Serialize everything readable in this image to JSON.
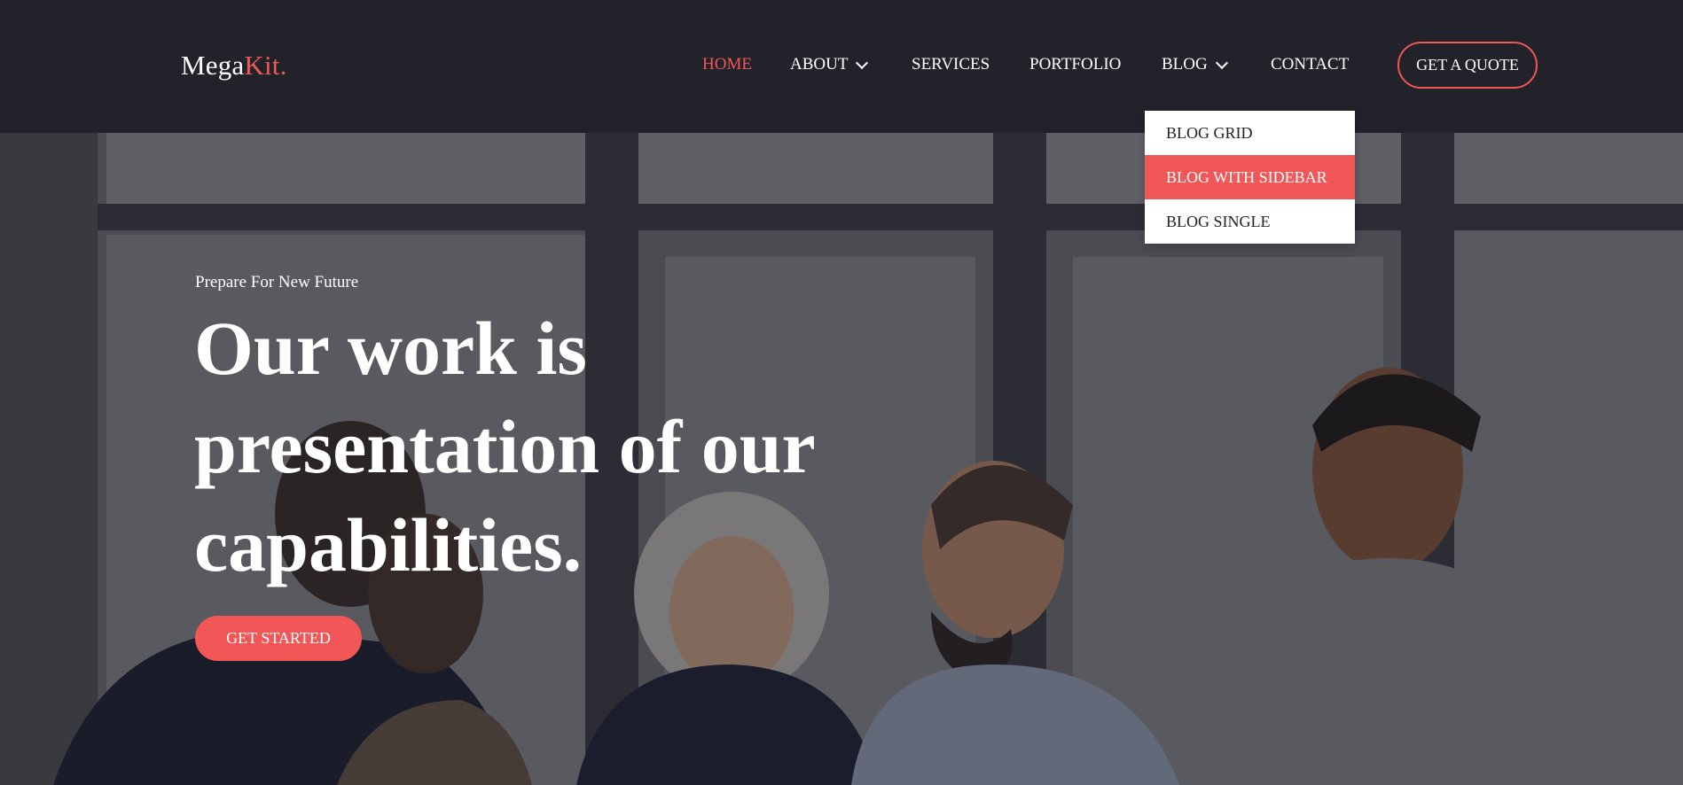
{
  "brand": {
    "name_main": "Mega",
    "name_accent": "Kit."
  },
  "nav": {
    "items": [
      {
        "label": "HOME",
        "active": true,
        "has_dropdown": false
      },
      {
        "label": "ABOUT",
        "active": false,
        "has_dropdown": true
      },
      {
        "label": "SERVICES",
        "active": false,
        "has_dropdown": false
      },
      {
        "label": "PORTFOLIO",
        "active": false,
        "has_dropdown": false
      },
      {
        "label": "BLOG",
        "active": false,
        "has_dropdown": true
      },
      {
        "label": "CONTACT",
        "active": false,
        "has_dropdown": false
      }
    ],
    "cta_label": "GET A QUOTE"
  },
  "blog_dropdown": {
    "items": [
      {
        "label": "BLOG GRID",
        "highlighted": false
      },
      {
        "label": "BLOG WITH SIDEBAR",
        "highlighted": true
      },
      {
        "label": "BLOG SINGLE",
        "highlighted": false
      }
    ]
  },
  "hero": {
    "subtitle": "Prepare For New Future",
    "title_line1": "Our work is",
    "title_line2": "presentation of our",
    "title_line3": "capabilities.",
    "button_label": "GET STARTED"
  },
  "colors": {
    "accent": "#f25757",
    "header_bg": "#21222a",
    "text_light": "#ffffff"
  }
}
